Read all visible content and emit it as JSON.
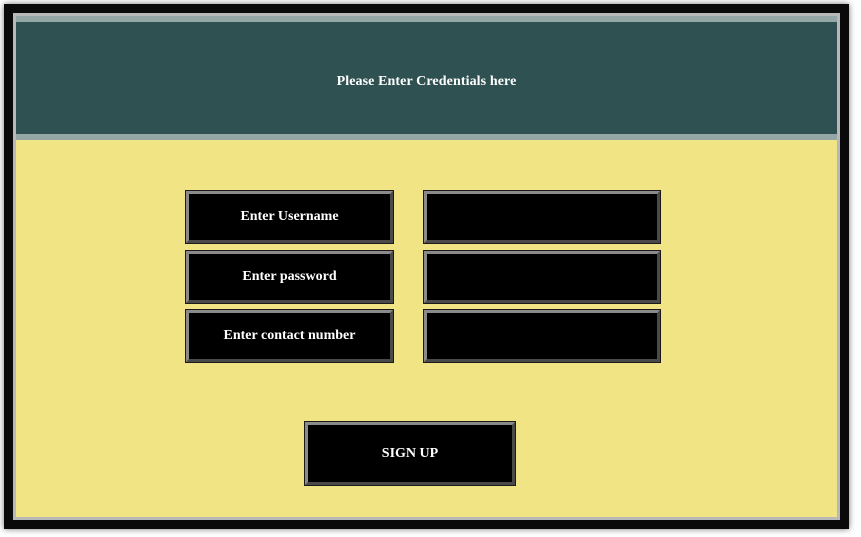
{
  "header": {
    "title": "Please Enter Credentials here"
  },
  "form": {
    "username_label": "Enter Username",
    "username_value": "",
    "password_label": "Enter password",
    "password_value": "",
    "contact_label": "Enter contact number",
    "contact_value": ""
  },
  "actions": {
    "signup_label": "SIGN UP"
  },
  "colors": {
    "header_bg": "#2f5151",
    "header_rule": "#95a6a6",
    "body_bg": "#f0e484",
    "field_bg": "#000000",
    "text": "#ffffff"
  }
}
